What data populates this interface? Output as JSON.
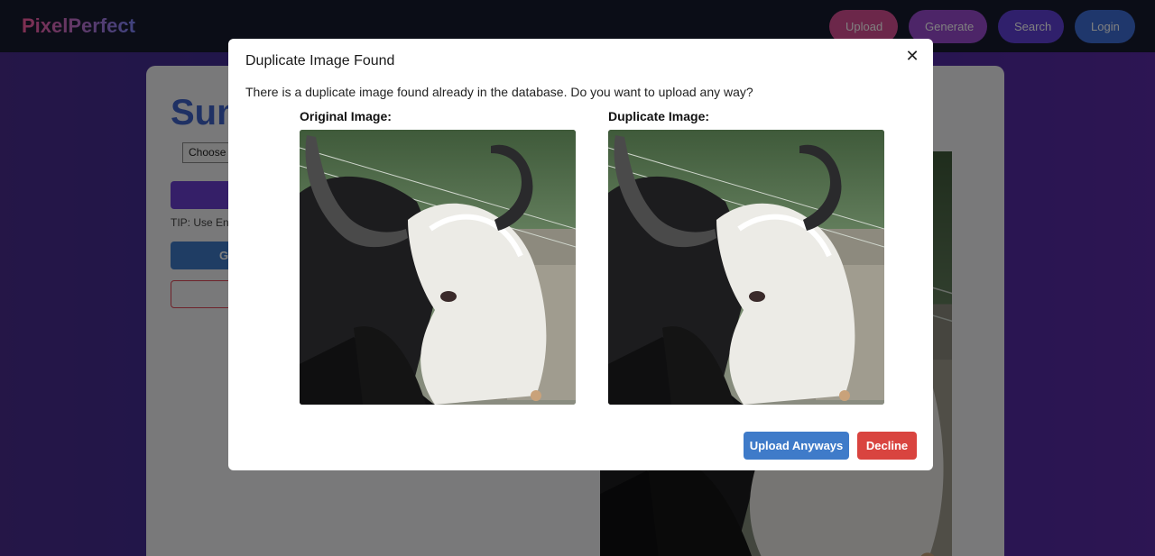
{
  "navbar": {
    "brand": "PixelPerfect",
    "buttons": {
      "upload": "Upload",
      "generate": "Generate",
      "search": "Search",
      "login": "Login"
    }
  },
  "page": {
    "title_visible": "Sum",
    "file_input_visible": "Choose",
    "tip_visible": "TIP: Use Enh",
    "generate_visible": "G"
  },
  "modal": {
    "title": "Duplicate Image Found",
    "message": "There is a duplicate image found already in the database. Do you want to upload any way?",
    "original_label": "Original Image:",
    "duplicate_label": "Duplicate Image:",
    "upload_anyways_label": "Upload Anyways",
    "decline_label": "Decline",
    "close_glyph": "✕"
  },
  "colors": {
    "nav_bg": "#161a2e",
    "upload": "#d94f95",
    "generate": "#9a4ad0",
    "search": "#6040d8",
    "login": "#3f6fd8",
    "primary_blue": "#3f7bc9",
    "danger_red": "#d9443f"
  }
}
